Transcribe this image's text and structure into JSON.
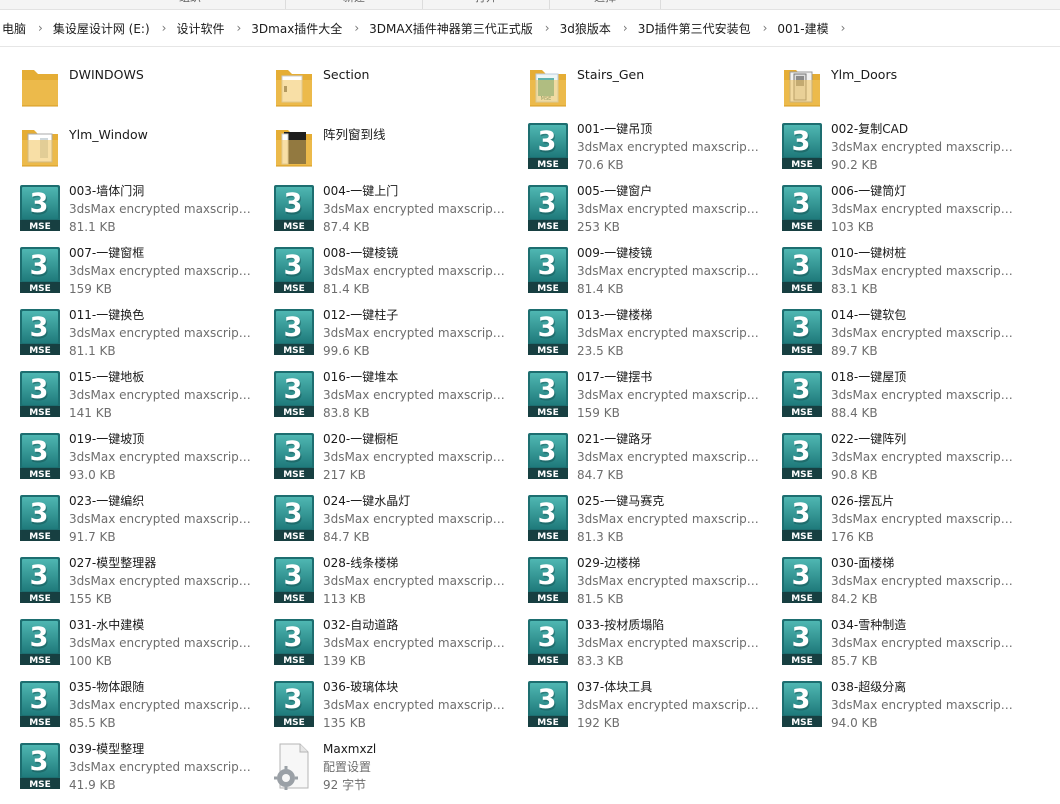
{
  "ribbon": {
    "groups": [
      "组织",
      "新建",
      "打开",
      "选择"
    ]
  },
  "breadcrumb": [
    "电脑",
    "集设屋设计网 (E:)",
    "设计软件",
    "3Dmax插件大全",
    "3DMAX插件神器第三代正式版",
    "3d狼版本",
    "3D插件第三代安装包",
    "001-建模"
  ],
  "files": [
    {
      "kind": "folder",
      "icon": "folder-yellow-icon",
      "name": "DWINDOWS"
    },
    {
      "kind": "folder",
      "icon": "folder-section-icon",
      "name": "Section"
    },
    {
      "kind": "folder",
      "icon": "folder-stairs-icon",
      "name": "Stairs_Gen"
    },
    {
      "kind": "folder",
      "icon": "folder-doors-icon",
      "name": "Ylm_Doors"
    },
    {
      "kind": "folder",
      "icon": "folder-window-icon",
      "name": "Ylm_Window"
    },
    {
      "kind": "folder",
      "icon": "folder-dark-icon",
      "name": "阵列窗到线"
    },
    {
      "kind": "mse",
      "name": "001-一键吊顶",
      "type": "3dsMax encrypted maxscript f...",
      "size": "70.6 KB"
    },
    {
      "kind": "mse",
      "name": "002-复制CAD",
      "type": "3dsMax encrypted maxscript f...",
      "size": "90.2 KB"
    },
    {
      "kind": "mse",
      "name": "003-墙体门洞",
      "type": "3dsMax encrypted maxscript f...",
      "size": "81.1 KB"
    },
    {
      "kind": "mse",
      "name": "004-一键上门",
      "type": "3dsMax encrypted maxscript f...",
      "size": "87.4 KB"
    },
    {
      "kind": "mse",
      "name": "005-一键窗户",
      "type": "3dsMax encrypted maxscript f...",
      "size": "253 KB"
    },
    {
      "kind": "mse",
      "name": "006-一键筒灯",
      "type": "3dsMax encrypted maxscript f...",
      "size": "103 KB"
    },
    {
      "kind": "mse",
      "name": "007-一键窗框",
      "type": "3dsMax encrypted maxscript f...",
      "size": "159 KB"
    },
    {
      "kind": "mse",
      "name": "008-一键棱镜",
      "type": "3dsMax encrypted maxscript f...",
      "size": "81.4 KB"
    },
    {
      "kind": "mse",
      "name": "009-一键棱镜",
      "type": "3dsMax encrypted maxscript f...",
      "size": "81.4 KB"
    },
    {
      "kind": "mse",
      "name": "010-一键树桩",
      "type": "3dsMax encrypted maxscript f...",
      "size": "83.1 KB"
    },
    {
      "kind": "mse",
      "name": "011-一键换色",
      "type": "3dsMax encrypted maxscript f...",
      "size": "81.1 KB"
    },
    {
      "kind": "mse",
      "name": "012-一键柱子",
      "type": "3dsMax encrypted maxscript f...",
      "size": "99.6 KB"
    },
    {
      "kind": "mse",
      "name": "013-一键楼梯",
      "type": "3dsMax encrypted maxscript f...",
      "size": "23.5 KB"
    },
    {
      "kind": "mse",
      "name": "014-一键软包",
      "type": "3dsMax encrypted maxscript f...",
      "size": "89.7 KB"
    },
    {
      "kind": "mse",
      "name": "015-一键地板",
      "type": "3dsMax encrypted maxscript f...",
      "size": "141 KB"
    },
    {
      "kind": "mse",
      "name": "016-一键堆本",
      "type": "3dsMax encrypted maxscript f...",
      "size": "83.8 KB"
    },
    {
      "kind": "mse",
      "name": "017-一键摆书",
      "type": "3dsMax encrypted maxscript f...",
      "size": "159 KB"
    },
    {
      "kind": "mse",
      "name": "018-一键屋顶",
      "type": "3dsMax encrypted maxscript f...",
      "size": "88.4 KB"
    },
    {
      "kind": "mse",
      "name": "019-一键坡顶",
      "type": "3dsMax encrypted maxscript f...",
      "size": "93.0 KB"
    },
    {
      "kind": "mse",
      "name": "020-一键橱柜",
      "type": "3dsMax encrypted maxscript f...",
      "size": "217 KB"
    },
    {
      "kind": "mse",
      "name": "021-一键路牙",
      "type": "3dsMax encrypted maxscript f...",
      "size": "84.7 KB"
    },
    {
      "kind": "mse",
      "name": "022-一键阵列",
      "type": "3dsMax encrypted maxscript f...",
      "size": "90.8 KB"
    },
    {
      "kind": "mse",
      "name": "023-一键编织",
      "type": "3dsMax encrypted maxscript f...",
      "size": "91.7 KB"
    },
    {
      "kind": "mse",
      "name": "024-一键水晶灯",
      "type": "3dsMax encrypted maxscript f...",
      "size": "84.7 KB"
    },
    {
      "kind": "mse",
      "name": "025-一键马赛克",
      "type": "3dsMax encrypted maxscript f...",
      "size": "81.3 KB"
    },
    {
      "kind": "mse",
      "name": "026-摆瓦片",
      "type": "3dsMax encrypted maxscript f...",
      "size": "176 KB"
    },
    {
      "kind": "mse",
      "name": "027-模型整理器",
      "type": "3dsMax encrypted maxscript f...",
      "size": "155 KB"
    },
    {
      "kind": "mse",
      "name": "028-线条楼梯",
      "type": "3dsMax encrypted maxscript f...",
      "size": "113 KB"
    },
    {
      "kind": "mse",
      "name": "029-边楼梯",
      "type": "3dsMax encrypted maxscript f...",
      "size": "81.5 KB"
    },
    {
      "kind": "mse",
      "name": "030-面楼梯",
      "type": "3dsMax encrypted maxscript f...",
      "size": "84.2 KB"
    },
    {
      "kind": "mse",
      "name": "031-水中建模",
      "type": "3dsMax encrypted maxscript f...",
      "size": "100 KB"
    },
    {
      "kind": "mse",
      "name": "032-自动道路",
      "type": "3dsMax encrypted maxscript f...",
      "size": "139 KB"
    },
    {
      "kind": "mse",
      "name": "033-按材质塌陷",
      "type": "3dsMax encrypted maxscript f...",
      "size": "83.3 KB"
    },
    {
      "kind": "mse",
      "name": "034-雪种制造",
      "type": "3dsMax encrypted maxscript f...",
      "size": "85.7 KB"
    },
    {
      "kind": "mse",
      "name": "035-物体跟随",
      "type": "3dsMax encrypted maxscript f...",
      "size": "85.5 KB"
    },
    {
      "kind": "mse",
      "name": "036-玻璃体块",
      "type": "3dsMax encrypted maxscript f...",
      "size": "135 KB"
    },
    {
      "kind": "mse",
      "name": "037-体块工具",
      "type": "3dsMax encrypted maxscript f...",
      "size": "192 KB"
    },
    {
      "kind": "mse",
      "name": "038-超级分离",
      "type": "3dsMax encrypted maxscript f...",
      "size": "94.0 KB"
    },
    {
      "kind": "mse",
      "name": "039-模型整理",
      "type": "3dsMax encrypted maxscript f...",
      "size": "41.9 KB"
    },
    {
      "kind": "config",
      "icon": "config-gear-file-icon",
      "name": "Maxmxzl",
      "type": "配置设置",
      "size": "92 字节"
    }
  ],
  "icon_labels": {
    "mse_badge": "MSE",
    "mse_glyph": "3"
  },
  "colors": {
    "mse_teal_dark": "#1c6f72",
    "mse_teal_light": "#3aa7a4",
    "folder_yellow": "#f2c55c",
    "folder_back": "#e5ad35"
  }
}
